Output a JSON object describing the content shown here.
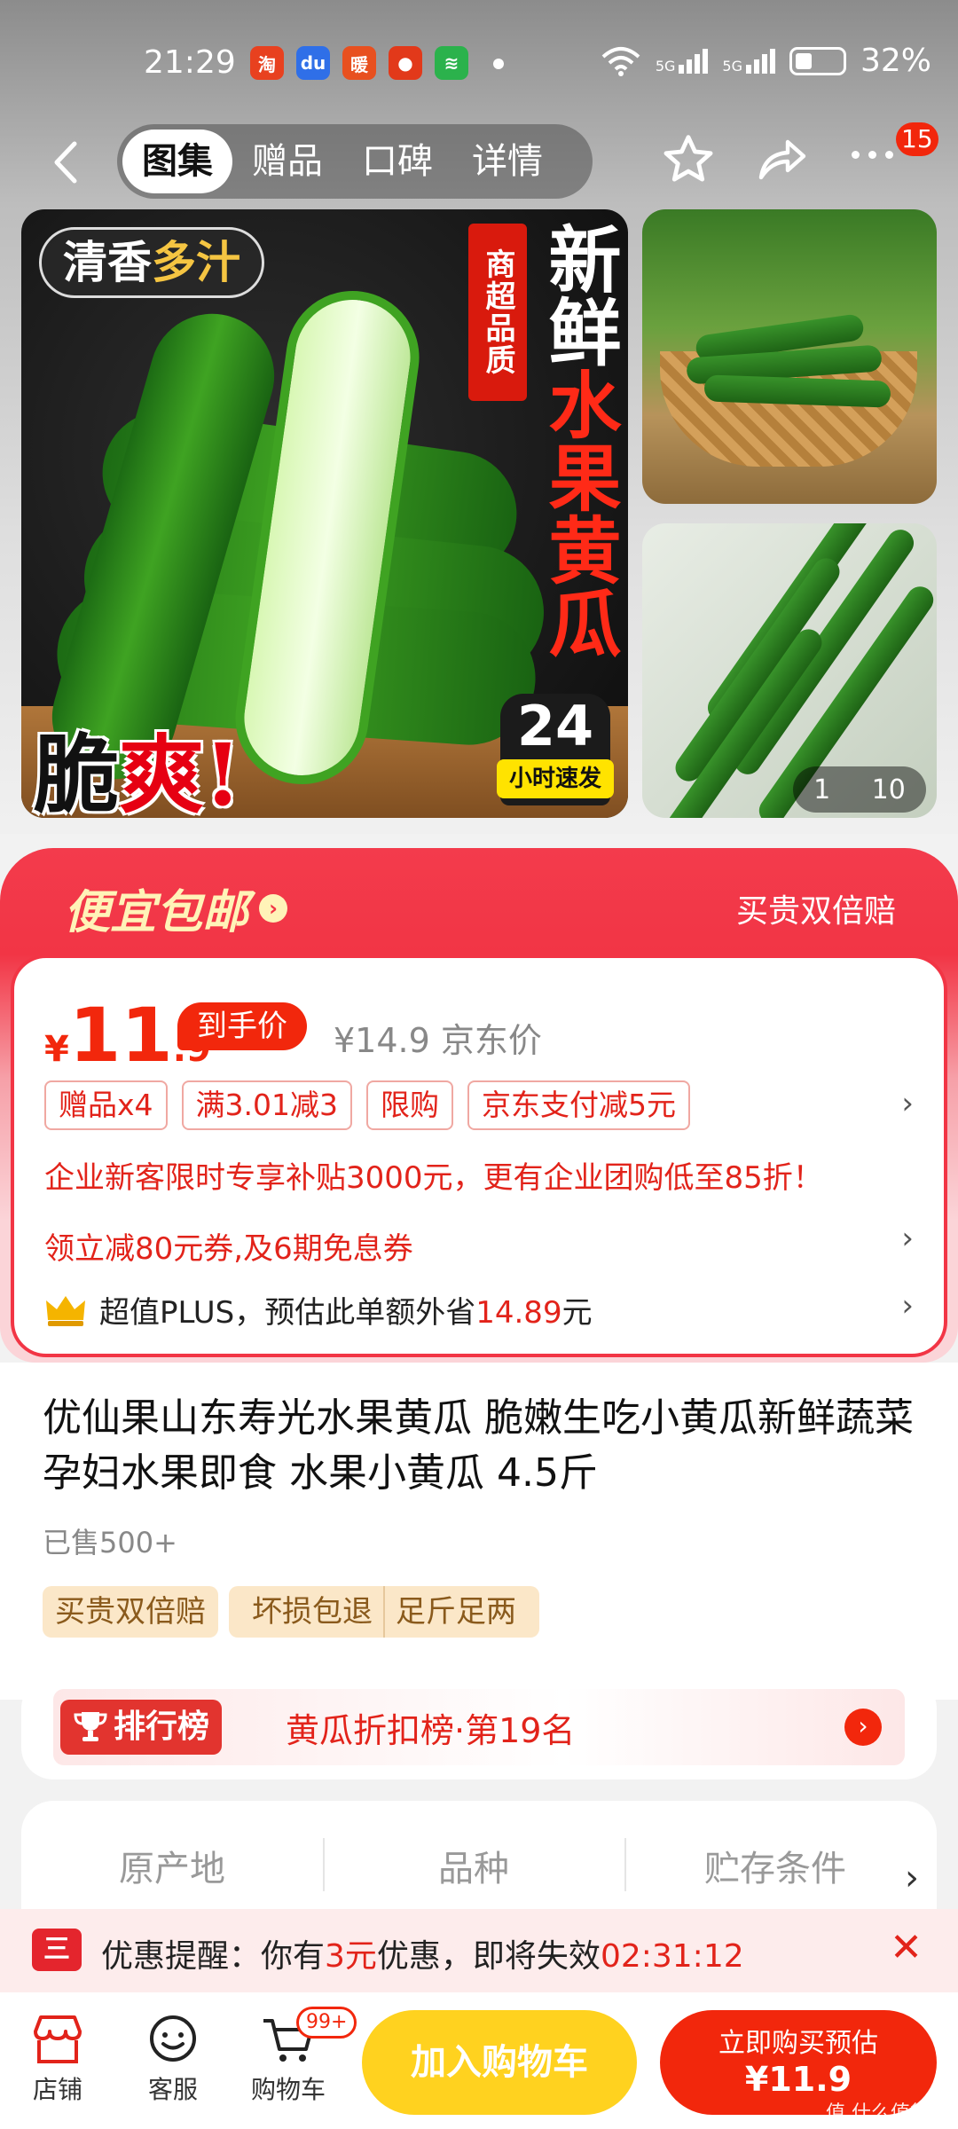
{
  "status_bar": {
    "time": "21:29",
    "battery": "32%",
    "network1": "5G",
    "network2": "5G"
  },
  "nav": {
    "tabs": [
      "图集",
      "赠品",
      "口碑",
      "详情"
    ],
    "active_tab": 0,
    "more_badge": "15"
  },
  "gallery": {
    "main": {
      "tag": "清香",
      "tag_highlight": "多汁",
      "red_label": "商超品质",
      "headline_top": "新鲜",
      "headline_red": "水果黄瓜",
      "crisp": "脆",
      "crisp_red": "爽!",
      "fast_number": "24",
      "fast_label": "小时速发"
    },
    "counter_current": "1",
    "counter_total": "10"
  },
  "promo": {
    "title": "便宜包邮",
    "insurance": "买贵双倍赔"
  },
  "price": {
    "symbol": "¥",
    "int": "11",
    "dec": ".9",
    "tag": "到手价",
    "jd_price": "¥14.9",
    "jd_label": "京东价",
    "chips": [
      "赠品x4",
      "满3.01减3",
      "限购",
      "京东支付减5元"
    ],
    "enterprise": "企业新客限时专享补贴3000元，更有企业团购低至85折！",
    "coupon": "领立减80元券,及6期免息券",
    "plus_prefix": "超值PLUS，预估此单额外省",
    "plus_value": "14.89",
    "plus_suffix": "元"
  },
  "product": {
    "title": "优仙果山东寿光水果黄瓜 脆嫩生吃小黄瓜新鲜蔬菜孕妇水果即食 水果小黄瓜 4.5斤",
    "sold": "已售500+",
    "guarantees": [
      "买贵双倍赔",
      "坏损包退",
      "足斤足两"
    ]
  },
  "ranking": {
    "label": "排行榜",
    "text": "黄瓜折扣榜·第19名"
  },
  "specs": [
    "原产地",
    "品种",
    "贮存条件"
  ],
  "reminder": {
    "icon_text": "三",
    "prefix": "优惠提醒：你有",
    "amount": "3元",
    "middle": "优惠，即将失效",
    "countdown": "02:31:12"
  },
  "bottom": {
    "shop": "店铺",
    "service": "客服",
    "cart": "购物车",
    "cart_badge": "99+",
    "add_cart": "加入购物车",
    "buy_line1": "立即购买预估",
    "buy_line2": "¥11.9"
  },
  "watermark": "值 什么值得买",
  "colors": {
    "accent_red": "#f2270c",
    "cart_yellow": "#ffd21f"
  }
}
